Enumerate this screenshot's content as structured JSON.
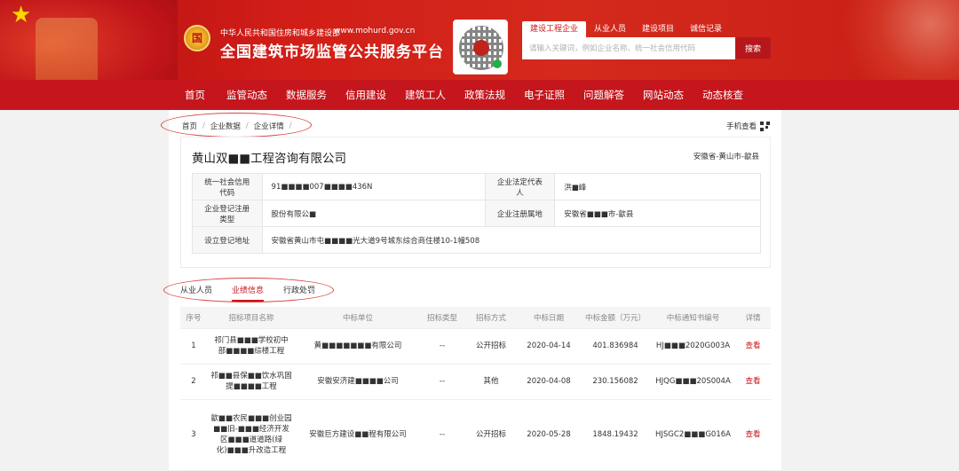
{
  "header": {
    "site_subtitle": "中华人民共和国住房和城乡建设部",
    "site_url": "www.mohurd.gov.cn",
    "site_title": "全国建筑市场监管公共服务平台",
    "emblem_text": "国"
  },
  "search": {
    "tabs": [
      "建设工程企业",
      "从业人员",
      "建设项目",
      "诚信记录"
    ],
    "active_tab": 0,
    "placeholder": "请输入关键词，例如企业名称、统一社会信用代码",
    "button_label": "搜索"
  },
  "nav": {
    "items": [
      "首页",
      "监管动态",
      "数据服务",
      "信用建设",
      "建筑工人",
      "政策法规",
      "电子证照",
      "问题解答",
      "网站动态",
      "动态核查"
    ]
  },
  "breadcrumb": {
    "items": [
      "首页",
      "企业数据",
      "企业详情"
    ]
  },
  "mobile_view_label": "手机查看",
  "company": {
    "name": "黄山双■■工程咨询有限公司",
    "location": "安徽省-黄山市-歙县",
    "fields": {
      "credit_code_label": "统一社会信用代码",
      "credit_code_value": "91■■■■007■■■■436N",
      "legal_rep_label": "企业法定代表人",
      "legal_rep_value": "洪■峰",
      "reg_type_label": "企业登记注册类型",
      "reg_type_value": "股份有限公■",
      "reg_place_label": "企业注册属地",
      "reg_place_value": "安徽省■■■市-歙县",
      "address_label": "设立登记地址",
      "address_value": "安徽省黄山市屯■■■■光大道9号城东综合商住楼10-1幢508"
    }
  },
  "tabs": {
    "items": [
      "从业人员",
      "业绩信息",
      "行政处罚"
    ],
    "active": 1
  },
  "results": {
    "headers": [
      "序号",
      "招标项目名称",
      "中标单位",
      "招标类型",
      "招标方式",
      "中标日期",
      "中标金额（万元）",
      "中标通知书编号",
      "详情"
    ],
    "rows": [
      [
        "1",
        "祁门县■■■学校初中部■■■■综楼工程",
        "黄■■■■■■■有限公司",
        "--",
        "公开招标",
        "2020-04-14",
        "401.836984",
        "HJ■■■2020G003A",
        "查看"
      ],
      [
        "2",
        "祁■■县保■■饮水巩固提■■■■工程",
        "安徽安济建■■■■公司",
        "--",
        "其他",
        "2020-04-08",
        "230.156082",
        "HJQG■■■20S004A",
        "查看"
      ],
      [
        "3",
        "歙■■农民■■■创业园■■旧-■■■经济开发区■■■道道路(绿化)■■■升改造工程",
        "安徽巨方建设■■程有限公司",
        "--",
        "公开招标",
        "2020-05-28",
        "1848.19432",
        "HJSGC2■■■G016A",
        "查看"
      ]
    ]
  },
  "colors": {
    "brand_red": "#c4161c",
    "annotation_red": "#d9433a"
  }
}
